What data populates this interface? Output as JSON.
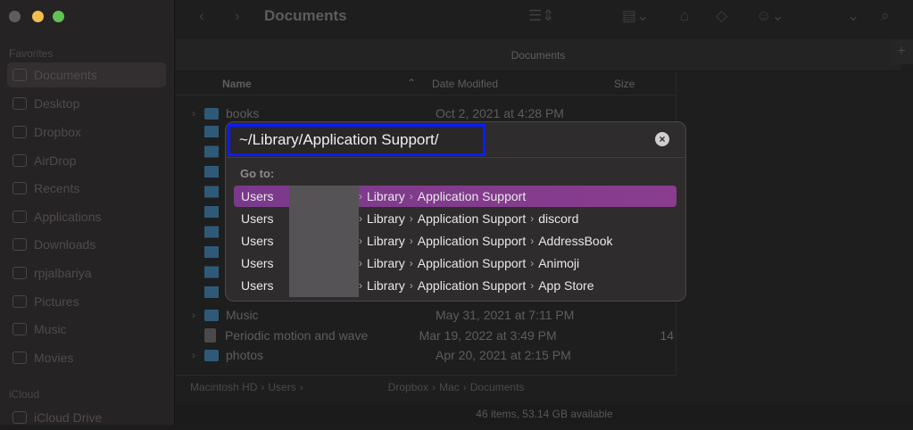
{
  "window": {
    "title": "Documents",
    "tab": "Documents",
    "add_tab": "+"
  },
  "sidebar": {
    "favorites_label": "Favorites",
    "icloud_label": "iCloud",
    "items": [
      "Documents",
      "Desktop",
      "Dropbox",
      "AirDrop",
      "Recents",
      "Applications",
      "Downloads",
      "rpjalbariya",
      "Pictures",
      "Music",
      "Movies"
    ],
    "icloud_items": [
      "iCloud Drive"
    ]
  },
  "columns": {
    "name": "Name",
    "date": "Date Modified",
    "size": "Size"
  },
  "files": [
    {
      "name": "books",
      "date": "Oct 2, 2021 at 4:28 PM",
      "size": "",
      "type": "folder"
    },
    {
      "name": "Music",
      "date": "May 31, 2021 at 7:11 PM",
      "size": "",
      "type": "folder"
    },
    {
      "name": "Periodic motion and wave",
      "date": "Mar 19, 2022 at 3:49 PM",
      "size": "14",
      "type": "doc"
    },
    {
      "name": "photos",
      "date": "Apr 20, 2021 at 2:15 PM",
      "size": "",
      "type": "folder"
    }
  ],
  "pathbar": [
    "Macintosh HD",
    "Users",
    "Dropbox",
    "Mac",
    "Documents"
  ],
  "status": "46 items, 53.14 GB available",
  "goto": {
    "input_value": "~/Library/Application Support/",
    "label": "Go to:",
    "close": "×",
    "suggestions": [
      [
        "Users",
        "Library",
        "Application Support"
      ],
      [
        "Users",
        "Library",
        "Application Support",
        "discord"
      ],
      [
        "Users",
        "Library",
        "Application Support",
        "AddressBook"
      ],
      [
        "Users",
        "Library",
        "Application Support",
        "Animoji"
      ],
      [
        "Users",
        "Library",
        "Application Support",
        "App Store"
      ]
    ]
  },
  "colors": {
    "highlight": "#7a3a8c",
    "focus_ring": "#0a1cff"
  }
}
